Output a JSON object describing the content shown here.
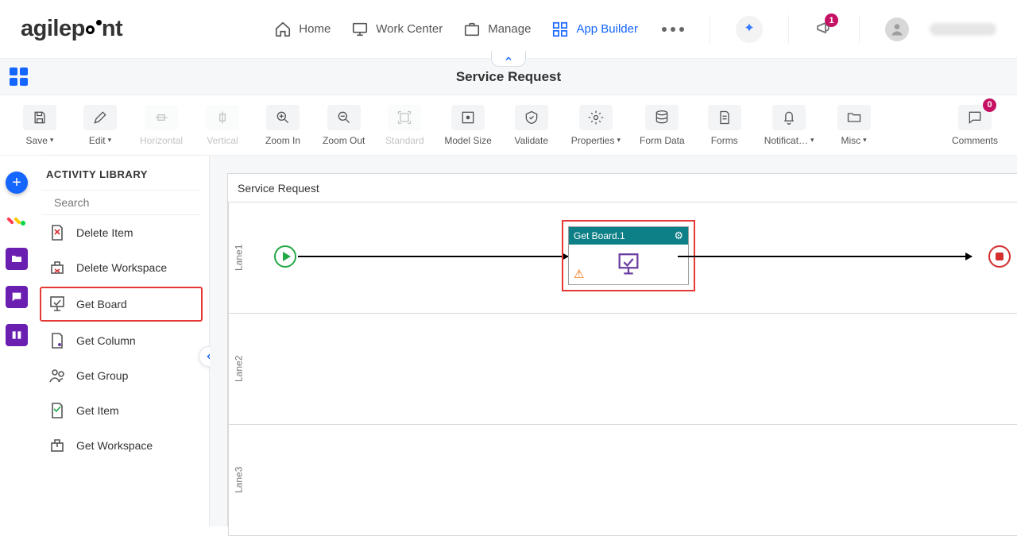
{
  "brand": "agilepoint",
  "nav": {
    "home": "Home",
    "workcenter": "Work Center",
    "manage": "Manage",
    "appbuilder": "App Builder",
    "notif_count": "1"
  },
  "page": {
    "title": "Service Request"
  },
  "toolbar": {
    "save": "Save",
    "edit": "Edit",
    "horizontal": "Horizontal",
    "vertical": "Vertical",
    "zoomin": "Zoom In",
    "zoomout": "Zoom Out",
    "standard": "Standard",
    "modelsize": "Model Size",
    "validate": "Validate",
    "properties": "Properties",
    "formdata": "Form Data",
    "forms": "Forms",
    "notifications": "Notificat…",
    "misc": "Misc",
    "comments": "Comments",
    "comments_count": "0"
  },
  "library": {
    "heading": "ACTIVITY LIBRARY",
    "search_placeholder": "Search",
    "items": [
      "Delete Item",
      "Delete Workspace",
      "Get Board",
      "Get Column",
      "Get Group",
      "Get Item",
      "Get Workspace"
    ],
    "selected_index": 2
  },
  "canvas": {
    "title": "Service Request",
    "lanes": [
      "Lane1",
      "Lane2",
      "Lane3"
    ],
    "node_title": "Get Board.1"
  }
}
